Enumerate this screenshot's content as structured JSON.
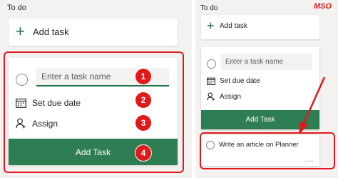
{
  "left": {
    "bucket_title": "To do",
    "add_task_label": "Add task",
    "new_task": {
      "placeholder": "Enter a task name",
      "set_due_date": "Set due date",
      "assign": "Assign",
      "submit_label": "Add Task"
    },
    "callouts": [
      "1",
      "2",
      "3",
      "4"
    ]
  },
  "right": {
    "bucket_title": "To do",
    "add_task_label": "Add task",
    "new_task": {
      "placeholder": "Enter a task name",
      "set_due_date": "Set due date",
      "assign": "Assign",
      "submit_label": "Add Task"
    },
    "created_task": {
      "title": "Write an article on Planner",
      "more": "..."
    }
  },
  "logo": "MSO",
  "colors": {
    "accent_green": "#217346",
    "button_green": "#2f7d52",
    "highlight_red": "#e0191b",
    "panel_bg": "#f3f2f1"
  },
  "icons": {
    "plus": "plus-icon",
    "calendar": "calendar-icon",
    "person": "person-icon",
    "circle": "complete-circle-icon",
    "more": "more-icon"
  }
}
